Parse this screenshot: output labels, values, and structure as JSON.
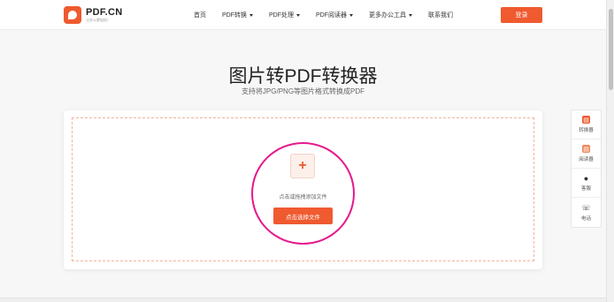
{
  "header": {
    "logo_title": "PDF.CN",
    "logo_subtitle": "让办公更轻松！",
    "nav": [
      {
        "label": "首页",
        "has_caret": false
      },
      {
        "label": "PDF转换",
        "has_caret": true
      },
      {
        "label": "PDF处理",
        "has_caret": true
      },
      {
        "label": "PDF阅读器",
        "has_caret": true
      },
      {
        "label": "更多办公工具",
        "has_caret": true
      },
      {
        "label": "联系我们",
        "has_caret": false
      }
    ],
    "login_label": "登录"
  },
  "hero": {
    "title": "图片转PDF转换器",
    "subtitle": "支持将JPG/PNG等图片格式转换成PDF"
  },
  "upload": {
    "icon": "plus-icon",
    "hint": "点击或拖拽添加文件",
    "button_label": "点击选择文件"
  },
  "side_panel": [
    {
      "label": "转换器",
      "icon": "converter-icon"
    },
    {
      "label": "阅读器",
      "icon": "reader-icon"
    },
    {
      "label": "客服",
      "icon": "qq-icon"
    },
    {
      "label": "电话",
      "icon": "phone-icon"
    }
  ],
  "colors": {
    "accent": "#ef5a2f",
    "highlight": "#e5198c"
  }
}
